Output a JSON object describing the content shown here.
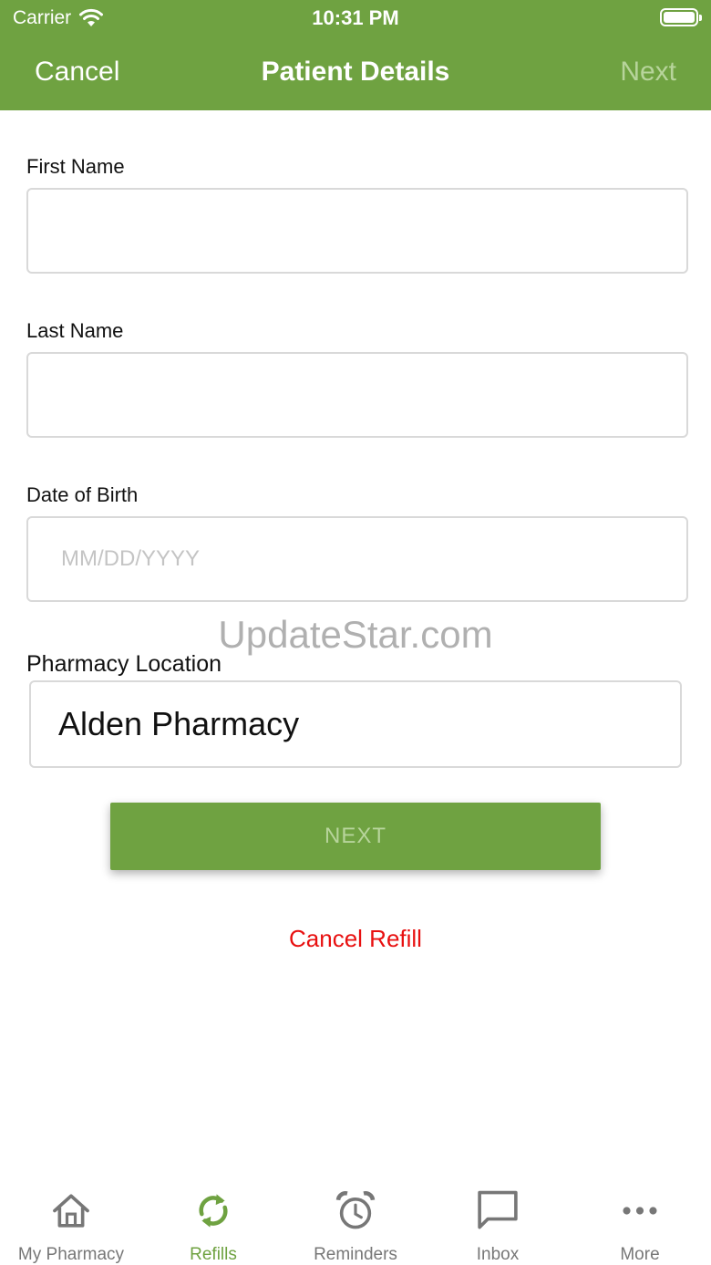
{
  "status_bar": {
    "carrier": "Carrier",
    "time": "10:31 PM"
  },
  "nav": {
    "cancel_label": "Cancel",
    "title": "Patient Details",
    "next_label": "Next"
  },
  "form": {
    "first_name": {
      "label": "First Name",
      "value": "",
      "placeholder": ""
    },
    "last_name": {
      "label": "Last Name",
      "value": "",
      "placeholder": ""
    },
    "dob": {
      "label": "Date of Birth",
      "value": "",
      "placeholder": "MM/DD/YYYY"
    },
    "pharmacy": {
      "label": "Pharmacy Location",
      "value": "Alden Pharmacy"
    }
  },
  "watermark": "UpdateStar.com",
  "next_button_label": "NEXT",
  "cancel_refill_label": "Cancel Refill",
  "tabs": [
    {
      "label": "My Pharmacy",
      "icon": "home-icon",
      "active": false
    },
    {
      "label": "Refills",
      "icon": "refresh-icon",
      "active": true
    },
    {
      "label": "Reminders",
      "icon": "alarm-clock-icon",
      "active": false
    },
    {
      "label": "Inbox",
      "icon": "chat-bubble-icon",
      "active": false
    },
    {
      "label": "More",
      "icon": "more-dots-icon",
      "active": false
    }
  ],
  "colors": {
    "brand_green": "#6fa241",
    "disabled_text": "#b7d49b",
    "danger_red": "#e81010",
    "tab_inactive": "#777777"
  }
}
